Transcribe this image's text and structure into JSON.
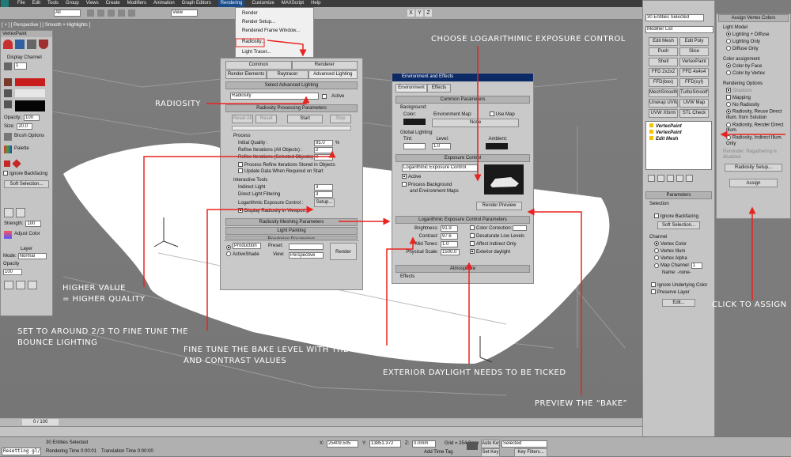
{
  "menubar": {
    "items": [
      "File",
      "Edit",
      "Tools",
      "Group",
      "Views",
      "Create",
      "Modifiers",
      "Animation",
      "Graph Editors",
      "Rendering",
      "Customize",
      "MAXScript",
      "Help"
    ],
    "selection_filter": "All",
    "view_mode": "View"
  },
  "rendering_menu": {
    "items": [
      "Render",
      "Render Setup...",
      "Rendered Frame Window...",
      "Radiosity...",
      "Light Tracer..."
    ]
  },
  "viewport": {
    "label": "[ + ] [ Perspective ] [ Smooth + Highlights ]"
  },
  "vertexpaint": {
    "title": "VertexPaint",
    "display_channel": "Display Channel",
    "channel_value": "1",
    "opacity_label": "Opacity:",
    "opacity_value": "100",
    "size_label": "Size:",
    "size_value": "20.0",
    "brush_options": "Brush Options",
    "palette": "Palette",
    "ignore_backfacing": "Ignore Backfacing",
    "soft_selection": "Soft Selection...",
    "strength_label": "Strength:",
    "strength_value": "100",
    "adjust_color": "Adjust Color",
    "layer_header": "Layer",
    "mode_label": "Mode:",
    "mode_value": "Normal",
    "opacity2_label": "Opacity",
    "opacity2_value": "100"
  },
  "render_setup": {
    "tabs_row1": [
      "Common",
      "Renderer"
    ],
    "tabs_row2": [
      "Render Elements",
      "Raytracer",
      "Advanced Lighting"
    ],
    "select_adv": "Select Advanced Lighting",
    "lighting_value": "Radiosity",
    "active": "Active",
    "proc_params": "Radiosity Processing Parameters",
    "reset_all": "Reset All",
    "reset": "Reset",
    "start": "Start",
    "stop": "Stop",
    "process": "Process",
    "initial_quality": "Initial Quality :",
    "iq_value": "95.0",
    "iq_unit": "%",
    "refine_all": "Refine Iterations (All Objects) :",
    "refine_all_value": "2",
    "refine_sel": "Refine Iterations (Selected Objects) :",
    "refine_sel_value": "0",
    "process_refine": "Process Refine Iterations Stored in Objects",
    "update_data": "Update Data When Required on Start",
    "interactive": "Interactive Tools",
    "indirect": "Indirect Light",
    "indirect_value": "3",
    "direct": "Direct Light Filtering",
    "direct_value": "3",
    "log_exposure": "Logarithmic Exposure Control :",
    "setup": "Setup...",
    "display_radiosity": "Display Radiosity in Viewport",
    "meshing": "Radiosity Meshing Parameters",
    "light_painting": "Light Painting",
    "rendering_params": "Rendering Parameters",
    "production": "Production",
    "activeshade": "ActiveShade",
    "preset": "Preset:",
    "view_label": "View:",
    "view_value": "Perspective",
    "render": "Render"
  },
  "env_effects": {
    "title": "Environment and Effects",
    "tabs": [
      "Environment",
      "Effects"
    ],
    "common": "Common Parameters",
    "background": "Background:",
    "color": "Color:",
    "env_map": "Environment Map:",
    "use_map": "Use Map",
    "none": "None",
    "global_lighting": "Global Lighting:",
    "tint": "Tint:",
    "level": "Level:",
    "level_value": "1.0",
    "ambient": "Ambient:",
    "exposure_control": "Exposure Control",
    "exposure_value": "Logarithmic Exposure Control",
    "active": "Active",
    "process_bg": "Process Background",
    "env_maps": "and Environment Maps",
    "render_preview": "Render Preview",
    "log_params": "Logarithmic Exposure Control Parameters",
    "brightness": "Brightness:",
    "brightness_value": "91.9",
    "contrast": "Contrast:",
    "contrast_value": "97.6",
    "midtones": "Mid Tones:",
    "midtones_value": "1.0",
    "physical_scale": "Physical Scale:",
    "physical_value": "1500.0",
    "color_correction": "Color Correction:",
    "desaturate": "Desaturate Low Levels",
    "affect_indirect": "Affect Indirect Only",
    "exterior": "Exterior daylight",
    "atmosphere": "Atmosphere",
    "effects": "Effects"
  },
  "modifier_panel": {
    "selected": "30 Entities Selected",
    "modifier_list": "Modifier List",
    "buttons": [
      "Edit Mesh",
      "Edit Poly",
      "Push",
      "Slice",
      "Shell",
      "VertexPaint",
      "FFD 2x2x2",
      "FFD 4x4x4",
      "FFD(box)",
      "FFD(cyl)",
      "MeshSmooth",
      "TurboSmooth",
      "Unwrap UVW",
      "UVW Map",
      "UVW Xform",
      "STL Check"
    ],
    "stack": [
      "VertexPaint",
      "VertexPaint",
      "Edit Mesh"
    ]
  },
  "params": {
    "header": "Parameters",
    "selection": "Selection",
    "ignore_backfacing": "Ignore Backfacing",
    "soft_selection": "Soft Selection...",
    "channel": "Channel",
    "channels": [
      "Vertex Color",
      "Vertex Illum",
      "Vertex Alpha",
      "Map Channel"
    ],
    "map_value": "1",
    "name": "Name: -none-",
    "ignore_underlying": "Ignore Underlying Color",
    "preserve_layer": "Preserve Layer",
    "edit": "Edit..."
  },
  "assign_panel": {
    "header": "Assign Vertex Colors",
    "light_model": "Light Model",
    "lm_options": [
      "Lighting + Diffuse",
      "Lighting Only",
      "Diffuse Only"
    ],
    "color_assignment": "Color assignment",
    "ca_options": [
      "Color by Face",
      "Color by Vertex"
    ],
    "rendering_options": "Rendering Options",
    "shadows": "Shadows",
    "mapping": "Mapping",
    "ro_options": [
      "No Radiosity",
      "Radiosity, Reuse Direct Illum. from Solution",
      "Radiosity, Render Direct Illum.",
      "Radiosity, Indirect Illum. Only"
    ],
    "reminder": "Reminder: Regathering is disabled",
    "radiosity_setup": "Radiosity Setup...",
    "assign": "Assign"
  },
  "statusbar": {
    "frame": "0 / 100",
    "selected": "30 Entities Selected",
    "rendering_time": "Rendering Time 0:00:01",
    "translation_time": "Translation Time 0:00:00",
    "x_label": "X:",
    "x_value": "25409.505",
    "y_label": "Y:",
    "y_value": "13851.372",
    "z_label": "Z:",
    "z_value": "0.0mm",
    "grid": "Grid = 254.0mm",
    "add_time_tag": "Add Time Tag",
    "auto_key": "Auto Key",
    "set_key": "Set Key",
    "selected_dd": "Selected",
    "key_filters": "Key Filters...",
    "listener": "Resetting gl/"
  },
  "annotations": {
    "choose_log": "CHOOSE LOGARITHIMIC EXPOSURE CONTROL",
    "radiosity": "RADIOSITY",
    "higher1": "HIGHER VALUE",
    "higher2": "= HIGHER QUALITY",
    "set1": "SET TO AROUND 2/3 TO FINE TUNE THE",
    "set2": "BOUNCE LIGHTING",
    "fine1": "FINE TUNE THE BAKE LEVEL WITH THE BRIGHTNESS",
    "fine2": "AND CONTRAST VALUES",
    "exterior": "EXTERIOR DAYLIGHT NEEDS TO BE TICKED",
    "preview": "PREVIEW THE “BAKE”",
    "click": "CLICK TO ASSIGN"
  },
  "colors": {
    "accent": "#e8231f",
    "panel": "#c5c5c5",
    "viewport": "#7c7c7c",
    "title_blue": "#0b2a66"
  }
}
